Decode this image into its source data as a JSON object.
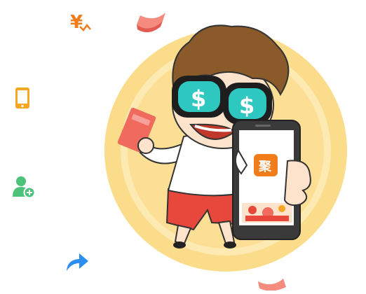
{
  "icons": {
    "yen": {
      "name": "yen-cashback-icon",
      "color": "#f07c1c"
    },
    "phone": {
      "name": "mobile-phone-icon",
      "color": "#f5a623"
    },
    "user_add": {
      "name": "add-user-icon",
      "color": "#4cc27a"
    },
    "share": {
      "name": "share-arrow-icon",
      "color": "#2b8ef0"
    }
  },
  "illustration": {
    "app_icon_char": "聚",
    "colors": {
      "coin_outer": "#fbdc8a",
      "coin_inner": "#fde9b2",
      "hair": "#8a5a2b",
      "shirt": "#ffffff",
      "shorts": "#e8473c",
      "lens": "#2fc8c0",
      "red_packet": "#f06a5e",
      "app_orange": "#f07c1c"
    }
  }
}
